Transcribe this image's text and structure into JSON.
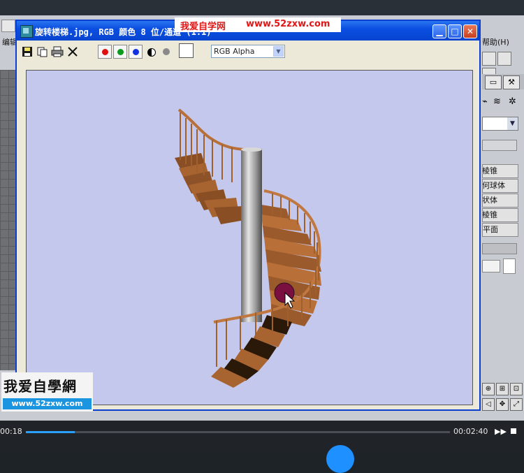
{
  "background_app": {
    "left_menu": "编辑",
    "right_menu": "帮助(H)",
    "right_tab_icon": "hammer-icon",
    "create_buttons": [
      "四棱锥",
      "几何球体",
      "管状体",
      "四棱锥",
      "平面"
    ]
  },
  "render_window": {
    "title": "旋转楼梯.jpg, RGB 颜色 8 位/通道 (1:1)",
    "channel_select": "RGB Alpha",
    "color_buttons": [
      {
        "name": "red-channel",
        "color": "#e01010"
      },
      {
        "name": "green-channel",
        "color": "#0a9a20"
      },
      {
        "name": "blue-channel",
        "color": "#1030e0"
      }
    ],
    "canvas_bg": "#c4c8ec",
    "image_subject": "spiral staircase render"
  },
  "watermark": {
    "banner_brand": "我爱自学网",
    "banner_url": "www.52zxw.com",
    "logo_text": "我爱自學網",
    "logo_url": "www.52zxw.com"
  },
  "player": {
    "current_time": "00:18",
    "total_time": "00:02:40",
    "progress": 0.115,
    "accent": "#2ba0ff"
  }
}
